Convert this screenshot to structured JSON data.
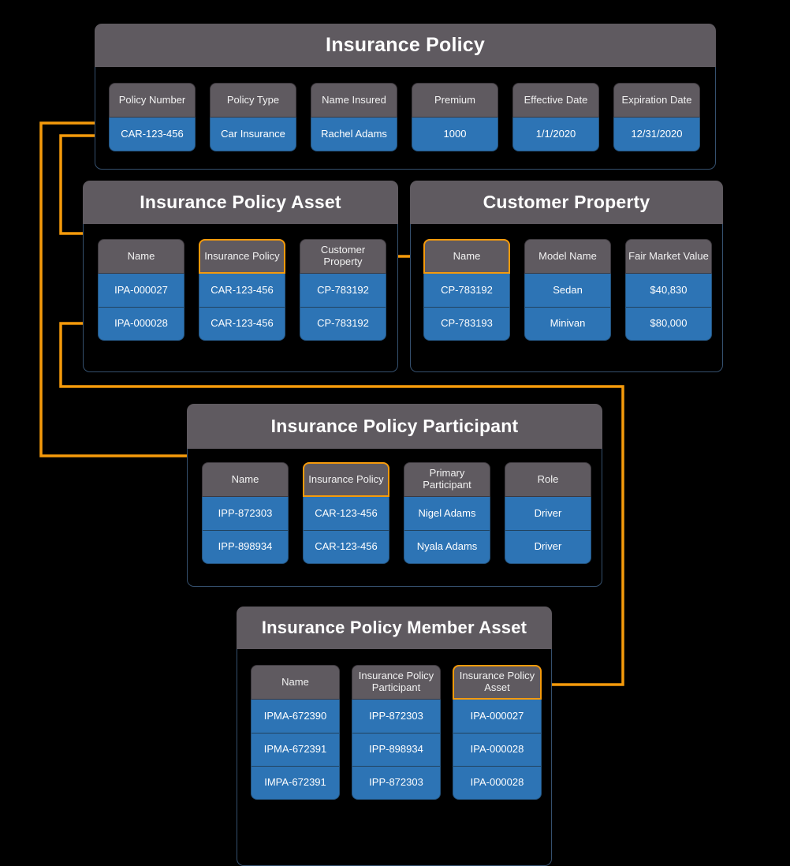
{
  "colors": {
    "background": "#000000",
    "header_grey": "#5f5a60",
    "data_blue": "#2d74b5",
    "card_border": "#35506e",
    "highlight_orange": "#f59a0b",
    "text": "#ffffff"
  },
  "entities": [
    {
      "id": "insurance-policy",
      "title": "Insurance Policy",
      "columns": [
        {
          "header": "Policy Number",
          "highlight": false,
          "cells": [
            "CAR-123-456"
          ]
        },
        {
          "header": "Policy Type",
          "highlight": false,
          "cells": [
            "Car Insurance"
          ]
        },
        {
          "header": "Name Insured",
          "highlight": false,
          "cells": [
            "Rachel Adams"
          ]
        },
        {
          "header": "Premium",
          "highlight": false,
          "cells": [
            "1000"
          ]
        },
        {
          "header": "Effective Date",
          "highlight": false,
          "cells": [
            "1/1/2020"
          ]
        },
        {
          "header": "Expiration Date",
          "highlight": false,
          "cells": [
            "12/31/2020"
          ]
        }
      ]
    },
    {
      "id": "insurance-policy-asset",
      "title": "Insurance Policy Asset",
      "columns": [
        {
          "header": "Name",
          "highlight": false,
          "cells": [
            "IPA-000027",
            "IPA-000028"
          ]
        },
        {
          "header": "Insurance Policy",
          "highlight": true,
          "cells": [
            "CAR-123-456",
            "CAR-123-456"
          ]
        },
        {
          "header": "Customer Property",
          "highlight": false,
          "cells": [
            "CP-783192",
            "CP-783192"
          ]
        }
      ]
    },
    {
      "id": "customer-property",
      "title": "Customer Property",
      "columns": [
        {
          "header": "Name",
          "highlight": true,
          "cells": [
            "CP-783192",
            "CP-783193"
          ]
        },
        {
          "header": "Model Name",
          "highlight": false,
          "cells": [
            "Sedan",
            "Minivan"
          ]
        },
        {
          "header": "Fair Market Value",
          "highlight": false,
          "cells": [
            "$40,830",
            "$80,000"
          ]
        }
      ]
    },
    {
      "id": "insurance-policy-participant",
      "title": "Insurance Policy Participant",
      "columns": [
        {
          "header": "Name",
          "highlight": false,
          "cells": [
            "IPP-872303",
            "IPP-898934"
          ]
        },
        {
          "header": "Insurance Policy",
          "highlight": true,
          "cells": [
            "CAR-123-456",
            "CAR-123-456"
          ]
        },
        {
          "header": "Primary Participant",
          "highlight": false,
          "cells": [
            "Nigel Adams",
            "Nyala Adams"
          ]
        },
        {
          "header": "Role",
          "highlight": false,
          "cells": [
            "Driver",
            "Driver"
          ]
        }
      ]
    },
    {
      "id": "insurance-policy-member-asset",
      "title": "Insurance Policy Member Asset",
      "columns": [
        {
          "header": "Name",
          "highlight": false,
          "cells": [
            "IPMA-672390",
            "IPMA-672391",
            "IMPA-672391"
          ]
        },
        {
          "header": "Insurance Policy Participant",
          "highlight": false,
          "cells": [
            "IPP-872303",
            "IPP-898934",
            "IPP-872303"
          ]
        },
        {
          "header": "Insurance Policy Asset",
          "highlight": true,
          "cells": [
            "IPA-000027",
            "IPA-000028",
            "IPA-000028"
          ]
        }
      ]
    }
  ],
  "relationships": [
    {
      "from": "insurance-policy.Policy Number",
      "to": "insurance-policy-asset.Insurance Policy"
    },
    {
      "from": "insurance-policy.Policy Number",
      "to": "insurance-policy-participant.Insurance Policy"
    },
    {
      "from": "insurance-policy-asset.Customer Property",
      "to": "customer-property.Name"
    },
    {
      "from": "insurance-policy-asset.Name",
      "to": "insurance-policy-member-asset.Insurance Policy Asset"
    }
  ]
}
